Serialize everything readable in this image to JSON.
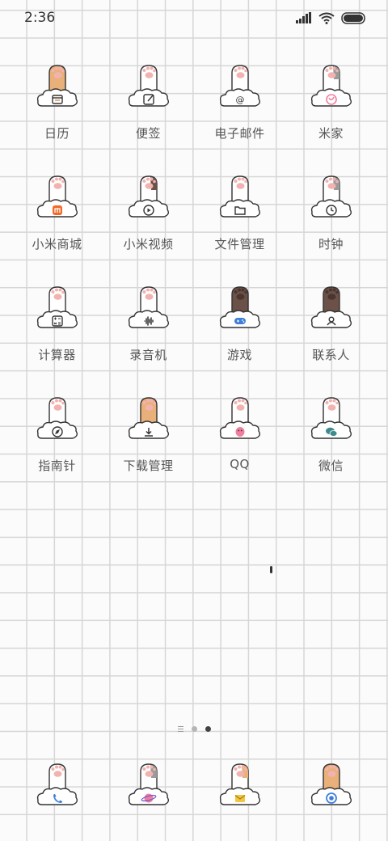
{
  "status_bar": {
    "time": "2:36"
  },
  "home": {
    "apps": [
      {
        "label": "日历",
        "icon": "calendar-icon",
        "paw": "orange"
      },
      {
        "label": "便签",
        "icon": "notes-icon",
        "paw": "white"
      },
      {
        "label": "电子邮件",
        "icon": "email-icon",
        "paw": "white"
      },
      {
        "label": "米家",
        "icon": "mijia-icon",
        "paw": "white-grey"
      },
      {
        "label": "小米商城",
        "icon": "mi-store-icon",
        "paw": "white"
      },
      {
        "label": "小米视频",
        "icon": "video-icon",
        "paw": "white-brown"
      },
      {
        "label": "文件管理",
        "icon": "folder-icon",
        "paw": "white"
      },
      {
        "label": "时钟",
        "icon": "clock-icon",
        "paw": "white-grey"
      },
      {
        "label": "计算器",
        "icon": "calculator-icon",
        "paw": "white"
      },
      {
        "label": "录音机",
        "icon": "recorder-icon",
        "paw": "white"
      },
      {
        "label": "游戏",
        "icon": "gamepad-icon",
        "paw": "brown"
      },
      {
        "label": "联系人",
        "icon": "contacts-icon",
        "paw": "brown"
      },
      {
        "label": "指南针",
        "icon": "compass-icon",
        "paw": "white"
      },
      {
        "label": "下载管理",
        "icon": "download-icon",
        "paw": "orange"
      },
      {
        "label": "QQ",
        "icon": "qq-icon",
        "paw": "white"
      },
      {
        "label": "微信",
        "icon": "wechat-icon",
        "paw": "white"
      }
    ]
  },
  "dock": {
    "apps": [
      {
        "icon": "phone-icon",
        "paw": "white"
      },
      {
        "icon": "browser-icon",
        "paw": "white-grey"
      },
      {
        "icon": "messages-icon",
        "paw": "white-orange"
      },
      {
        "icon": "camera-icon",
        "paw": "orange"
      }
    ]
  },
  "page_indicator": {
    "pages": 2,
    "current": 2
  },
  "colors": {
    "grid_line": "#d6d6d6",
    "background": "#fbfbfb",
    "label": "#555555",
    "outline": "#333333",
    "paw_orange": "#e9b07a",
    "paw_brown": "#6b5147",
    "pad_pink": "#f2b3b0",
    "accent_orange": "#f06a2a",
    "accent_blue": "#3f7fd9",
    "accent_pink": "#ef7f9d",
    "accent_teal": "#3e8b8e"
  }
}
